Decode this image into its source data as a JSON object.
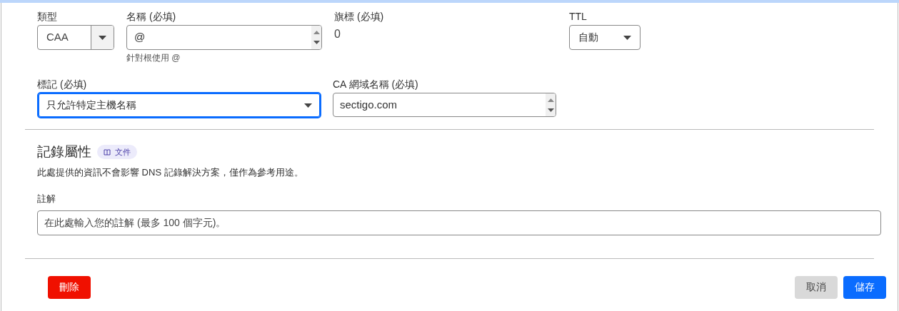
{
  "record": {
    "type": {
      "label": "類型",
      "value": "CAA"
    },
    "name": {
      "label": "名稱 (必填)",
      "value": "@",
      "hint": "針對根使用 @"
    },
    "flag": {
      "label": "旗標 (必填)",
      "value": "0"
    },
    "ttl": {
      "label": "TTL",
      "value": "自動"
    },
    "tag": {
      "label": "標記 (必填)",
      "value": "只允許特定主機名稱",
      "focused": true
    },
    "ca_domain": {
      "label": "CA 網域名稱 (必填)",
      "value": "sectigo.com"
    }
  },
  "attributes": {
    "title": "記錄屬性",
    "badge": "文件",
    "description": "此處提供的資訊不會影響 DNS 記錄解決方案，僅作為參考用途。",
    "comment": {
      "label": "註解",
      "placeholder": "在此處輸入您的註解 (最多 100 個字元)。"
    }
  },
  "buttons": [
    {
      "label": "刪除",
      "kind": "danger"
    },
    {
      "label": "取消",
      "kind": "secondary"
    },
    {
      "label": "儲存",
      "kind": "primary"
    }
  ]
}
